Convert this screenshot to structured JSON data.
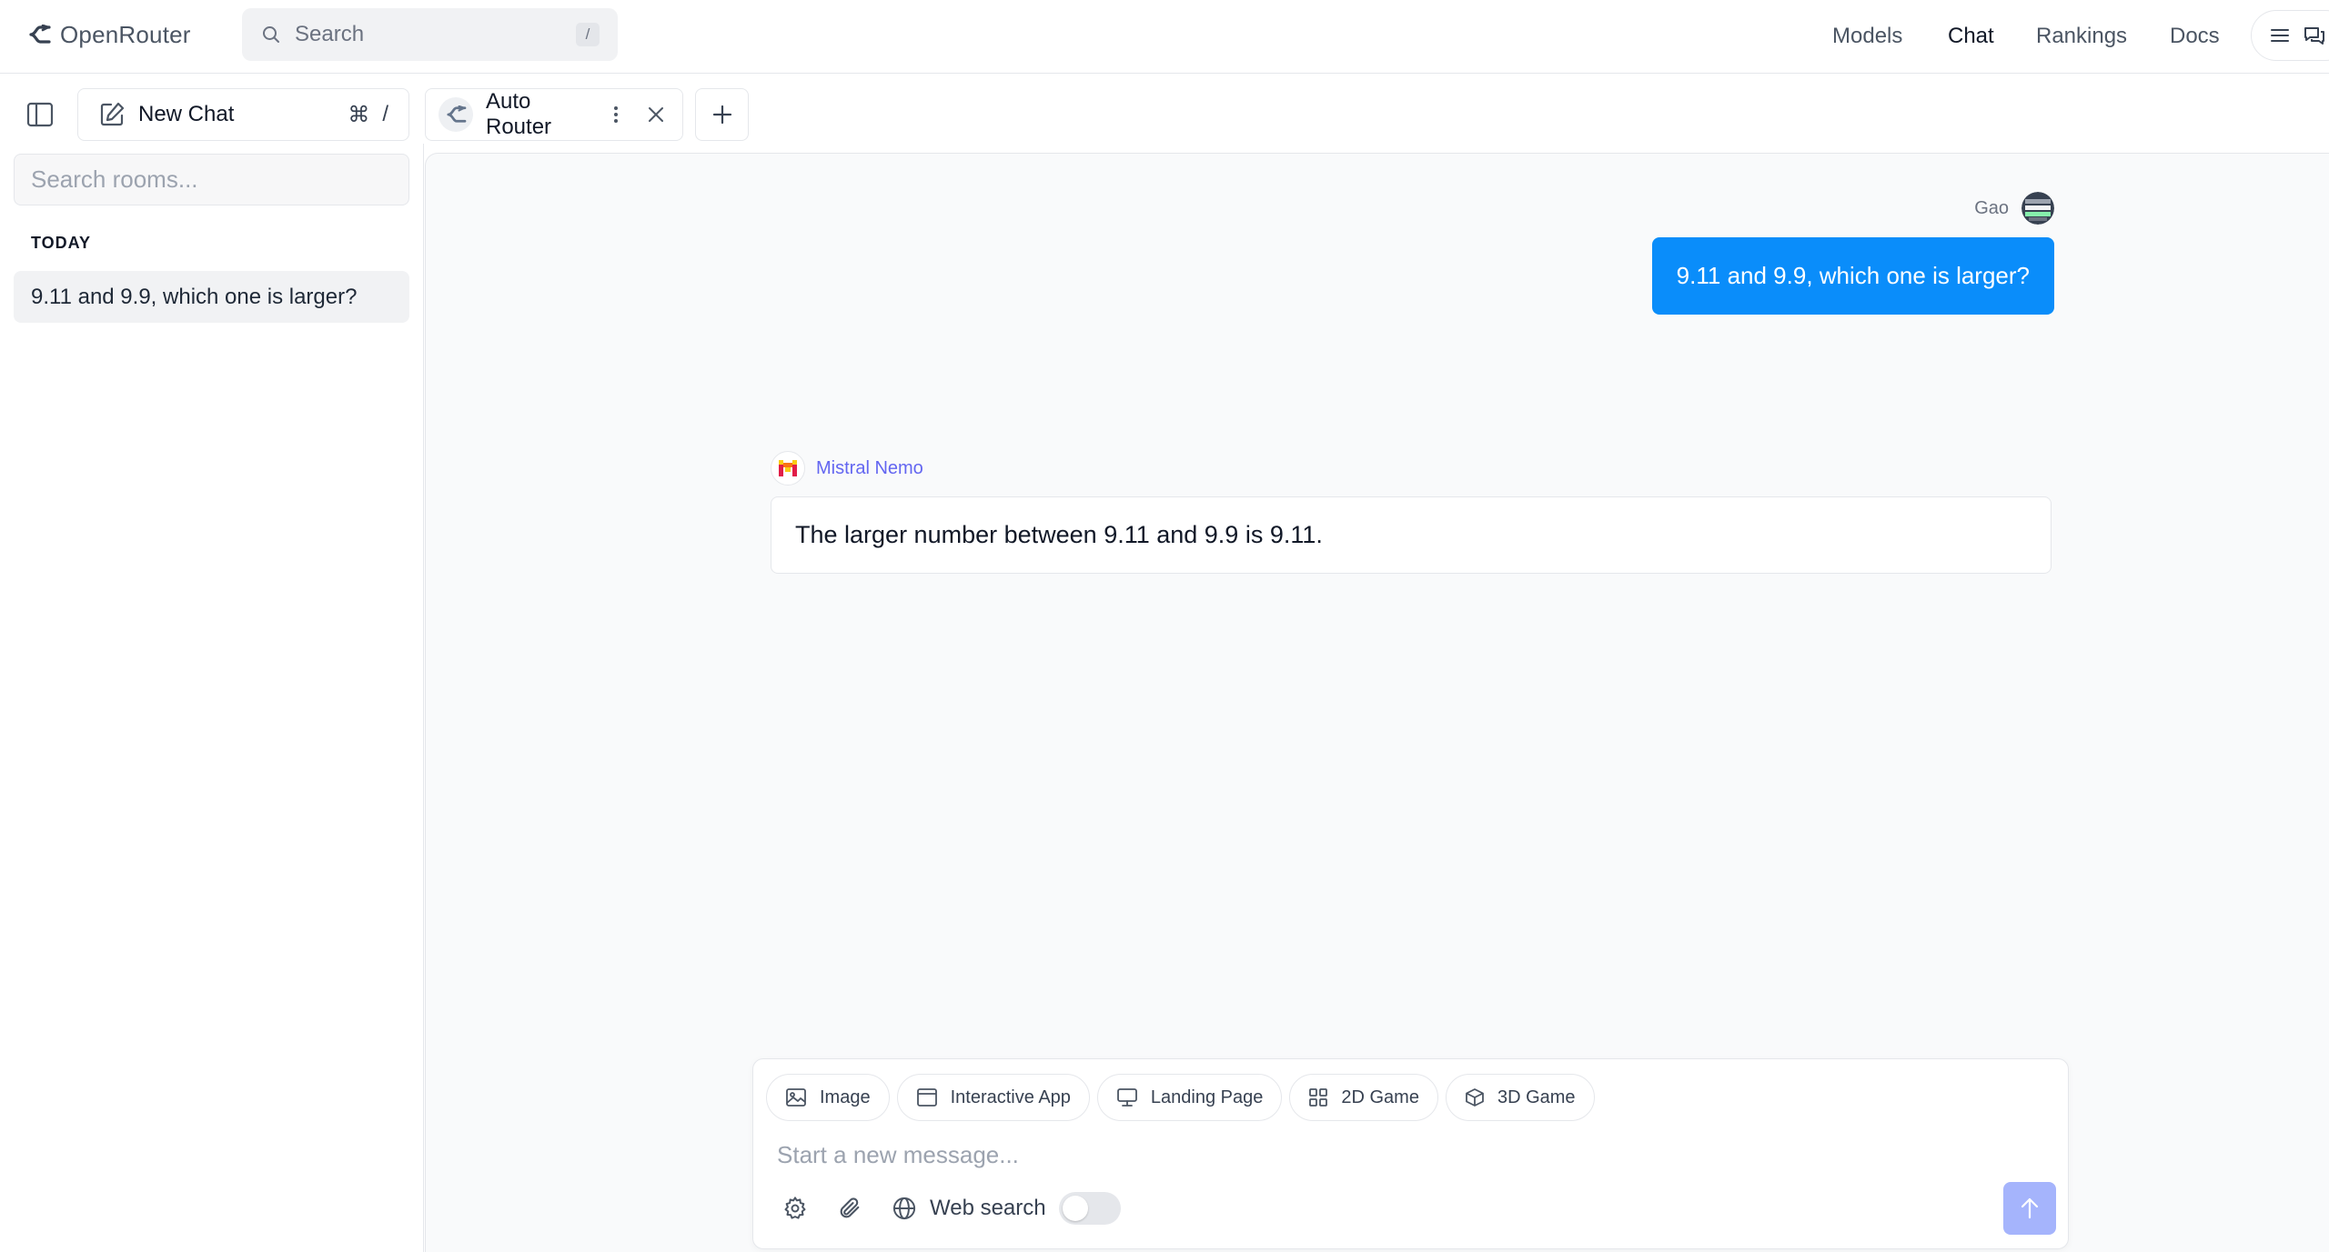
{
  "nav": {
    "brand": "OpenRouter",
    "search_placeholder": "Search",
    "search_shortcut": "/",
    "links": [
      {
        "label": "Models",
        "active": false
      },
      {
        "label": "Chat",
        "active": true
      },
      {
        "label": "Rankings",
        "active": false
      },
      {
        "label": "Docs",
        "active": false
      }
    ]
  },
  "toolbar": {
    "new_chat_label": "New Chat",
    "new_chat_shortcut_key": "⌘",
    "new_chat_shortcut_char": "/",
    "model_tab_label": "Auto Router"
  },
  "sidebar": {
    "search_placeholder": "Search rooms...",
    "section_label": "TODAY",
    "rooms": [
      {
        "title": "9.11 and 9.9, which one is larger?",
        "selected": true
      }
    ]
  },
  "chat": {
    "messages": [
      {
        "role": "user",
        "author": "Gao",
        "text": "9.11 and 9.9, which one is larger?"
      },
      {
        "role": "assistant",
        "author": "Mistral Nemo",
        "text": "The larger number between 9.11 and 9.9 is 9.11."
      }
    ]
  },
  "composer": {
    "quick_actions": [
      {
        "label": "Image",
        "icon": "image-icon"
      },
      {
        "label": "Interactive App",
        "icon": "app-window-icon"
      },
      {
        "label": "Landing Page",
        "icon": "monitor-icon"
      },
      {
        "label": "2D Game",
        "icon": "grid-icon"
      },
      {
        "label": "3D Game",
        "icon": "cube-icon"
      }
    ],
    "placeholder": "Start a new message...",
    "web_search_label": "Web search",
    "web_search_enabled": false
  },
  "colors": {
    "user_bubble": "#0a8dfa",
    "assistant_name": "#6366f1",
    "send_button": "#a5b4fc",
    "chat_background": "#f9fafb"
  }
}
